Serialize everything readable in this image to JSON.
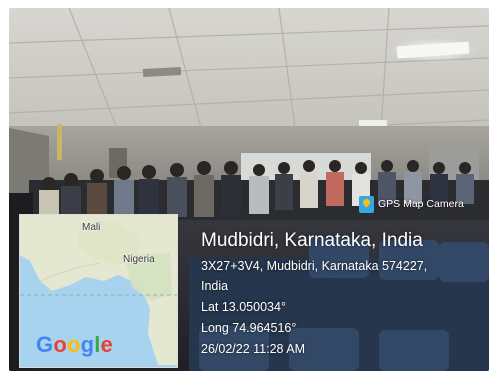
{
  "overlay": {
    "app_badge": "GPS Map Camera",
    "location_title": "Mudbidri, Karnataka, India",
    "address_line1": "3X27+3V4, Mudbidri, Karnataka 574227,",
    "address_line2": "India",
    "latitude": "Lat 13.050034°",
    "longitude": "Long 74.964516°",
    "datetime": "26/02/22 11:28 AM"
  },
  "map": {
    "label_mali": "Mali",
    "label_nigeria": "Nigeria",
    "logo_parts": [
      "G",
      "o",
      "o",
      "g",
      "l",
      "e"
    ],
    "logo_colors": [
      "#4285F4",
      "#EA4335",
      "#FBBC05",
      "#4285F4",
      "#34A853",
      "#EA4335"
    ]
  },
  "colors": {
    "ocean": "#a8d3ee",
    "land": "#e4e8d0",
    "badge": "#3aa6de"
  }
}
